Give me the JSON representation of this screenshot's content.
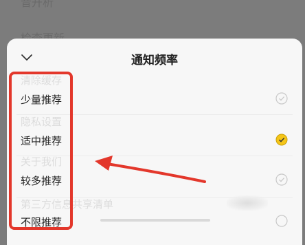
{
  "background": {
    "top_item": "音开析",
    "check_update": "检查更新"
  },
  "sheet": {
    "title": "通知频率",
    "collapse_icon": "chevron-down",
    "ghost_items": [
      "清除缓存",
      "隐私设置",
      "关于我们",
      "第三方信息共享清单"
    ],
    "options": [
      {
        "label": "少量推荐",
        "selected": false
      },
      {
        "label": "适中推荐",
        "selected": true
      },
      {
        "label": "较多推荐",
        "selected": false
      },
      {
        "label": "不限推荐",
        "selected": false
      }
    ]
  },
  "colors": {
    "accent": "#f5c518",
    "annotation": "#e3372b",
    "unselected_radio": "#c8c8c8"
  }
}
